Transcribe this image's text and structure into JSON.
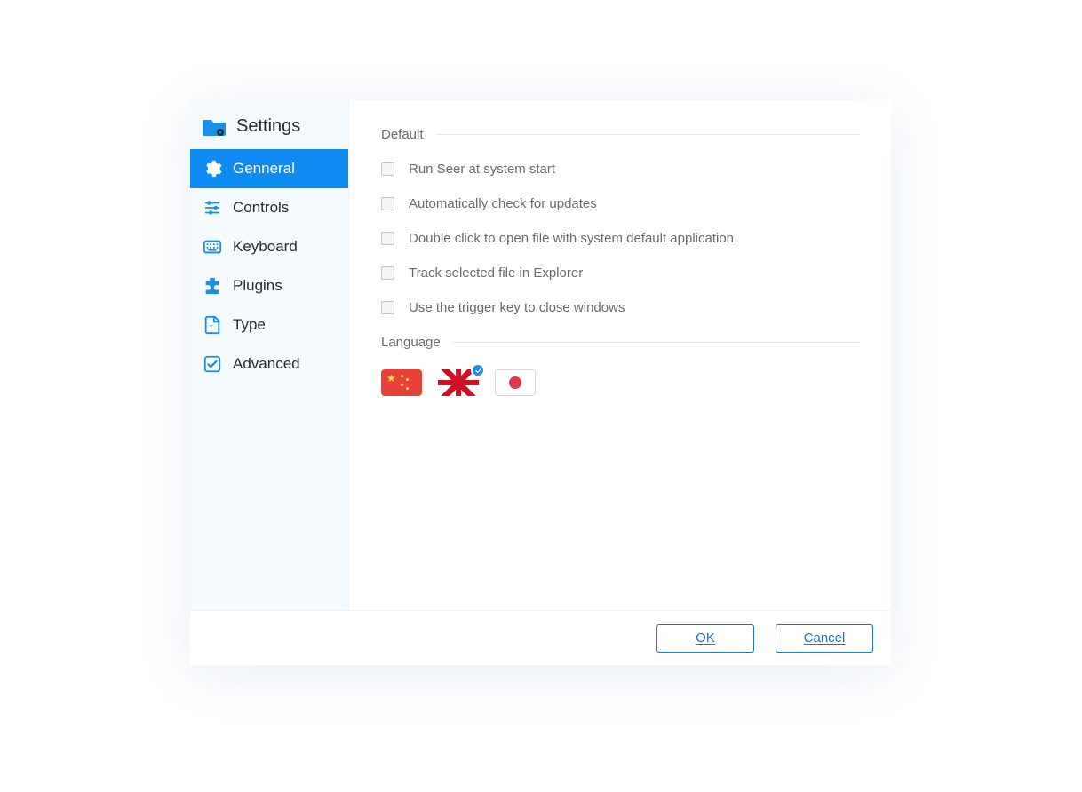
{
  "title": "Settings",
  "sidebar": {
    "items": [
      {
        "label": "Genneral",
        "icon": "gear-icon",
        "active": true
      },
      {
        "label": "Controls",
        "icon": "sliders-icon",
        "active": false
      },
      {
        "label": "Keyboard",
        "icon": "keyboard-icon",
        "active": false
      },
      {
        "label": "Plugins",
        "icon": "plugin-icon",
        "active": false
      },
      {
        "label": "Type",
        "icon": "file-type-icon",
        "active": false
      },
      {
        "label": "Advanced",
        "icon": "advanced-icon",
        "active": false
      }
    ]
  },
  "sections": {
    "default": {
      "title": "Default",
      "options": [
        {
          "label": "Run Seer at system start",
          "checked": false
        },
        {
          "label": "Automatically check for updates",
          "checked": false
        },
        {
          "label": "Double click to open file with system default application",
          "checked": false
        },
        {
          "label": "Track selected file in Explorer",
          "checked": false
        },
        {
          "label": "Use the trigger key to close windows",
          "checked": false
        }
      ]
    },
    "language": {
      "title": "Language",
      "options": [
        {
          "name": "chinese",
          "selected": false
        },
        {
          "name": "english",
          "selected": true
        },
        {
          "name": "japanese",
          "selected": false
        }
      ]
    }
  },
  "footer": {
    "ok_label": "OK",
    "cancel_label": "Cancel"
  },
  "colors": {
    "accent": "#0d8bf2",
    "sidebar_bg": "#f5fafe",
    "text_muted": "#6a6a6a",
    "border": "#e6e6e6",
    "button_border": "#1e73c9"
  }
}
